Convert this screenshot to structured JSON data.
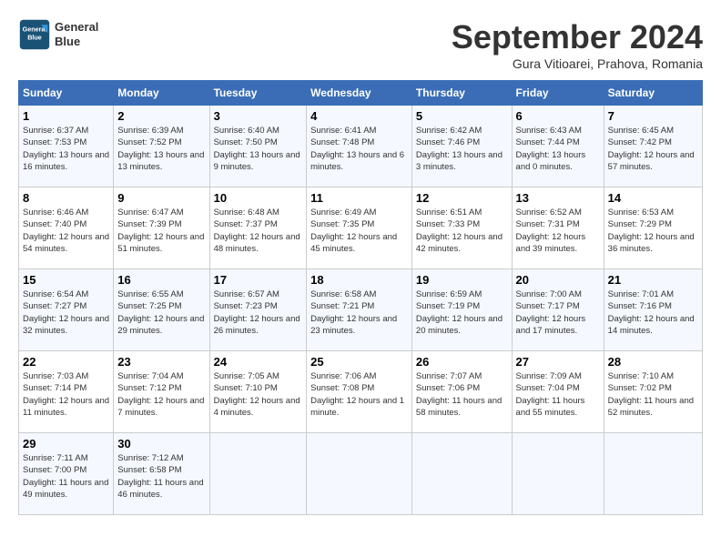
{
  "header": {
    "logo_line1": "General",
    "logo_line2": "Blue",
    "month": "September 2024",
    "location": "Gura Vitioarei, Prahova, Romania"
  },
  "columns": [
    "Sunday",
    "Monday",
    "Tuesday",
    "Wednesday",
    "Thursday",
    "Friday",
    "Saturday"
  ],
  "weeks": [
    [
      {
        "day": "1",
        "info": "Sunrise: 6:37 AM\nSunset: 7:53 PM\nDaylight: 13 hours and 16 minutes."
      },
      {
        "day": "2",
        "info": "Sunrise: 6:39 AM\nSunset: 7:52 PM\nDaylight: 13 hours and 13 minutes."
      },
      {
        "day": "3",
        "info": "Sunrise: 6:40 AM\nSunset: 7:50 PM\nDaylight: 13 hours and 9 minutes."
      },
      {
        "day": "4",
        "info": "Sunrise: 6:41 AM\nSunset: 7:48 PM\nDaylight: 13 hours and 6 minutes."
      },
      {
        "day": "5",
        "info": "Sunrise: 6:42 AM\nSunset: 7:46 PM\nDaylight: 13 hours and 3 minutes."
      },
      {
        "day": "6",
        "info": "Sunrise: 6:43 AM\nSunset: 7:44 PM\nDaylight: 13 hours and 0 minutes."
      },
      {
        "day": "7",
        "info": "Sunrise: 6:45 AM\nSunset: 7:42 PM\nDaylight: 12 hours and 57 minutes."
      }
    ],
    [
      {
        "day": "8",
        "info": "Sunrise: 6:46 AM\nSunset: 7:40 PM\nDaylight: 12 hours and 54 minutes."
      },
      {
        "day": "9",
        "info": "Sunrise: 6:47 AM\nSunset: 7:39 PM\nDaylight: 12 hours and 51 minutes."
      },
      {
        "day": "10",
        "info": "Sunrise: 6:48 AM\nSunset: 7:37 PM\nDaylight: 12 hours and 48 minutes."
      },
      {
        "day": "11",
        "info": "Sunrise: 6:49 AM\nSunset: 7:35 PM\nDaylight: 12 hours and 45 minutes."
      },
      {
        "day": "12",
        "info": "Sunrise: 6:51 AM\nSunset: 7:33 PM\nDaylight: 12 hours and 42 minutes."
      },
      {
        "day": "13",
        "info": "Sunrise: 6:52 AM\nSunset: 7:31 PM\nDaylight: 12 hours and 39 minutes."
      },
      {
        "day": "14",
        "info": "Sunrise: 6:53 AM\nSunset: 7:29 PM\nDaylight: 12 hours and 36 minutes."
      }
    ],
    [
      {
        "day": "15",
        "info": "Sunrise: 6:54 AM\nSunset: 7:27 PM\nDaylight: 12 hours and 32 minutes."
      },
      {
        "day": "16",
        "info": "Sunrise: 6:55 AM\nSunset: 7:25 PM\nDaylight: 12 hours and 29 minutes."
      },
      {
        "day": "17",
        "info": "Sunrise: 6:57 AM\nSunset: 7:23 PM\nDaylight: 12 hours and 26 minutes."
      },
      {
        "day": "18",
        "info": "Sunrise: 6:58 AM\nSunset: 7:21 PM\nDaylight: 12 hours and 23 minutes."
      },
      {
        "day": "19",
        "info": "Sunrise: 6:59 AM\nSunset: 7:19 PM\nDaylight: 12 hours and 20 minutes."
      },
      {
        "day": "20",
        "info": "Sunrise: 7:00 AM\nSunset: 7:17 PM\nDaylight: 12 hours and 17 minutes."
      },
      {
        "day": "21",
        "info": "Sunrise: 7:01 AM\nSunset: 7:16 PM\nDaylight: 12 hours and 14 minutes."
      }
    ],
    [
      {
        "day": "22",
        "info": "Sunrise: 7:03 AM\nSunset: 7:14 PM\nDaylight: 12 hours and 11 minutes."
      },
      {
        "day": "23",
        "info": "Sunrise: 7:04 AM\nSunset: 7:12 PM\nDaylight: 12 hours and 7 minutes."
      },
      {
        "day": "24",
        "info": "Sunrise: 7:05 AM\nSunset: 7:10 PM\nDaylight: 12 hours and 4 minutes."
      },
      {
        "day": "25",
        "info": "Sunrise: 7:06 AM\nSunset: 7:08 PM\nDaylight: 12 hours and 1 minute."
      },
      {
        "day": "26",
        "info": "Sunrise: 7:07 AM\nSunset: 7:06 PM\nDaylight: 11 hours and 58 minutes."
      },
      {
        "day": "27",
        "info": "Sunrise: 7:09 AM\nSunset: 7:04 PM\nDaylight: 11 hours and 55 minutes."
      },
      {
        "day": "28",
        "info": "Sunrise: 7:10 AM\nSunset: 7:02 PM\nDaylight: 11 hours and 52 minutes."
      }
    ],
    [
      {
        "day": "29",
        "info": "Sunrise: 7:11 AM\nSunset: 7:00 PM\nDaylight: 11 hours and 49 minutes."
      },
      {
        "day": "30",
        "info": "Sunrise: 7:12 AM\nSunset: 6:58 PM\nDaylight: 11 hours and 46 minutes."
      },
      {
        "day": "",
        "info": ""
      },
      {
        "day": "",
        "info": ""
      },
      {
        "day": "",
        "info": ""
      },
      {
        "day": "",
        "info": ""
      },
      {
        "day": "",
        "info": ""
      }
    ]
  ]
}
